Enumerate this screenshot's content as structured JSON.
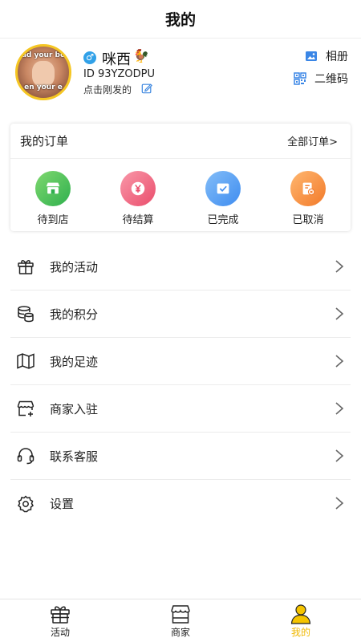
{
  "header": {
    "title": "我的"
  },
  "profile": {
    "avatar_caption_top": "ad your bo",
    "avatar_caption_bottom": "en your e",
    "gender_symbol": "♂",
    "nickname": "咪西",
    "nickname_emoji": "🐓",
    "user_id": "ID 93YZODPU",
    "signature": "点击刚发的",
    "album_label": "相册",
    "qrcode_label": "二维码"
  },
  "orders": {
    "title": "我的订单",
    "all_link": "全部订单>",
    "items": [
      {
        "label": "待到店",
        "icon": "store-icon",
        "color": "#3dbb57"
      },
      {
        "label": "待结算",
        "icon": "yen-icon",
        "color": "#ee5675"
      },
      {
        "label": "已完成",
        "icon": "check-card-icon",
        "color": "#4a93f1"
      },
      {
        "label": "已取消",
        "icon": "cancel-doc-icon",
        "color": "#f5843a"
      }
    ]
  },
  "menu": [
    {
      "label": "我的活动",
      "icon": "gift-icon"
    },
    {
      "label": "我的积分",
      "icon": "coins-icon"
    },
    {
      "label": "我的足迹",
      "icon": "map-icon"
    },
    {
      "label": "商家入驻",
      "icon": "shop-add-icon"
    },
    {
      "label": "联系客服",
      "icon": "headset-icon"
    },
    {
      "label": "设置",
      "icon": "gear-icon"
    }
  ],
  "tabbar": [
    {
      "label": "活动",
      "icon": "gift-icon",
      "active": false
    },
    {
      "label": "商家",
      "icon": "shop-icon",
      "active": false
    },
    {
      "label": "我的",
      "icon": "person-icon",
      "active": true
    }
  ],
  "colors": {
    "accent": "#f0b800",
    "avatar_border": "#f5c623",
    "gender": "#31a1e8"
  }
}
